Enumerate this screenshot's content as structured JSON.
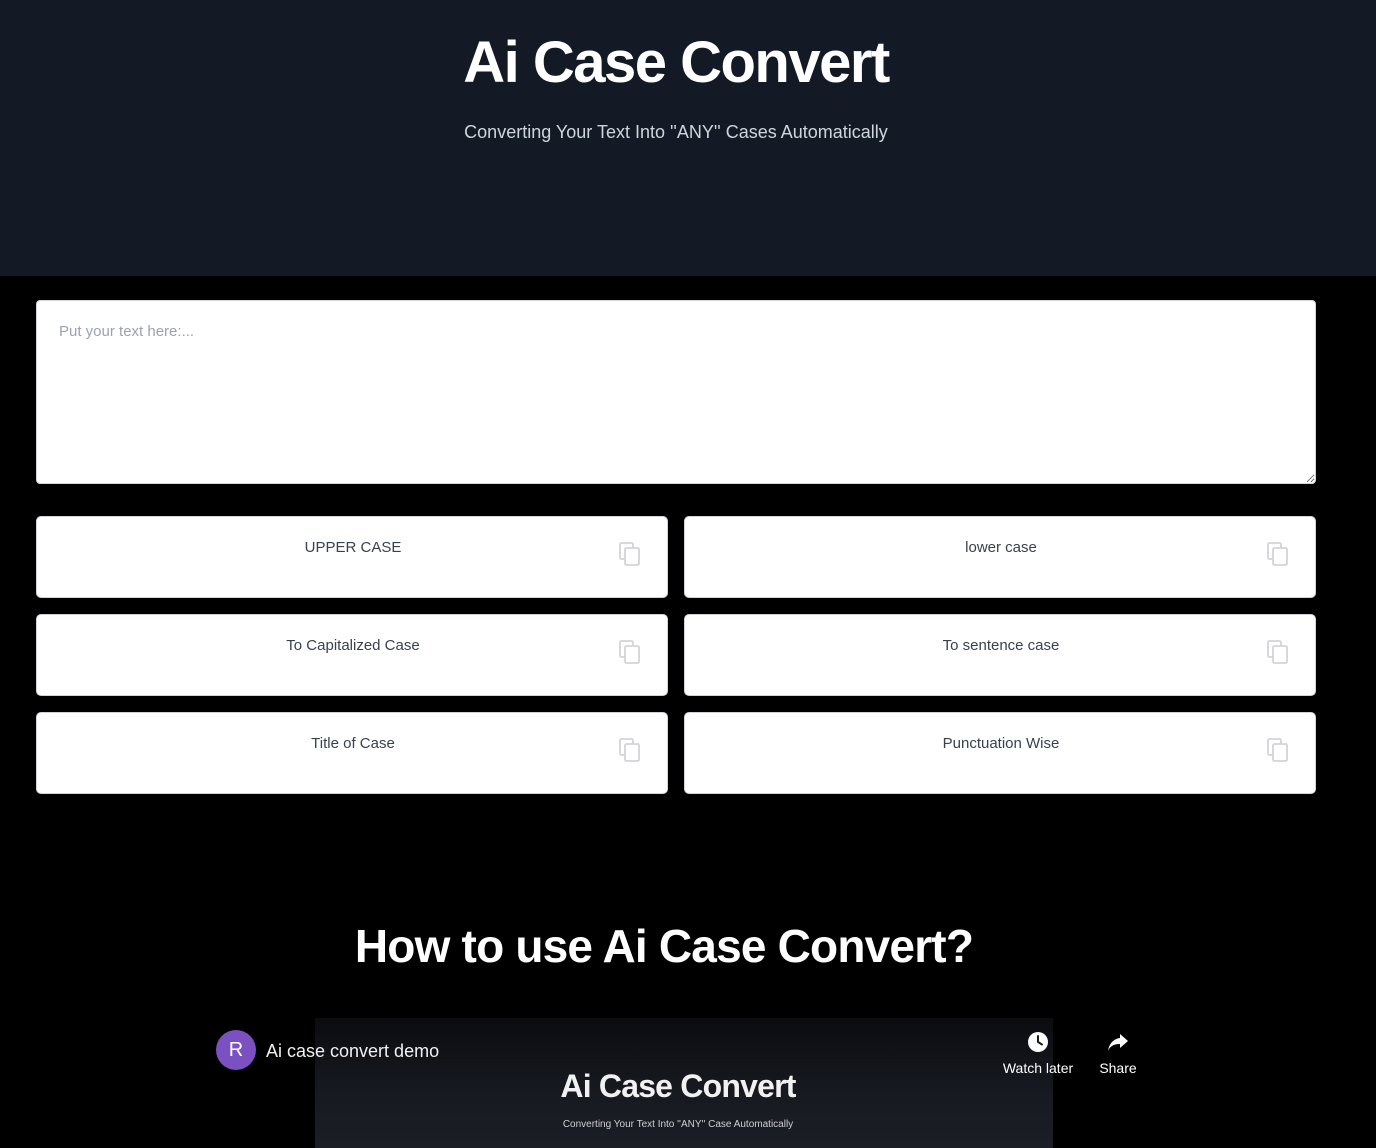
{
  "hero": {
    "title": "Ai Case Convert",
    "subtitle": "Converting Your Text Into ''ANY'' Cases Automatically",
    "background": "#131a26"
  },
  "input": {
    "placeholder": "Put your text here:...",
    "value": ""
  },
  "case_buttons": [
    {
      "label": "UPPER CASE",
      "icon": "copy-icon"
    },
    {
      "label": "lower case",
      "icon": "copy-icon"
    },
    {
      "label": "To Capitalized Case",
      "icon": "copy-icon"
    },
    {
      "label": "To sentence case",
      "icon": "copy-icon"
    },
    {
      "label": "Title of Case",
      "icon": "copy-icon"
    },
    {
      "label": "Punctuation Wise",
      "icon": "copy-icon"
    }
  ],
  "how_to": {
    "title": "How to use Ai Case Convert?"
  },
  "video": {
    "channel_initial": "R",
    "title": "Ai case convert demo",
    "thumbnail_title": "Ai Case Convert",
    "thumbnail_subtitle": "Converting Your Text Into ''ANY'' Case Automatically",
    "watch_later_label": "Watch later",
    "share_label": "Share",
    "avatar_color": "#7b50c0"
  }
}
